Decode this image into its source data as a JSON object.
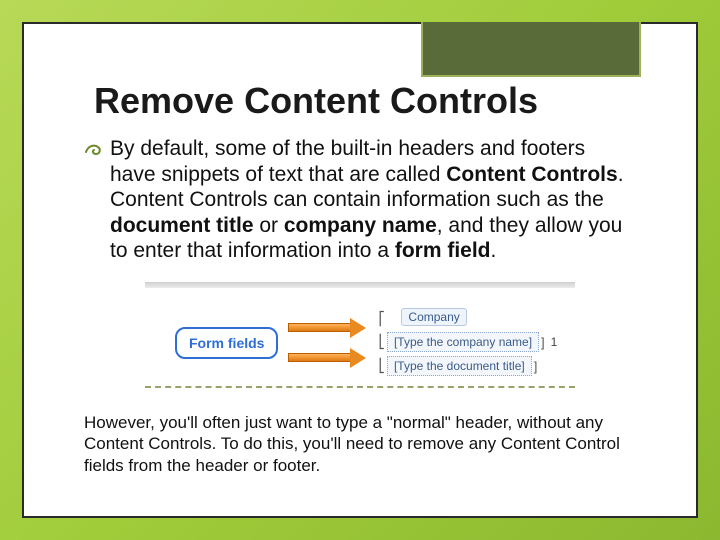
{
  "title": "Remove Content Controls",
  "body": {
    "p1_a": "By default, some of the built-in headers and footers have snippets of text that are called ",
    "p1_b": "Content Controls",
    "p1_c": ". Content Controls can contain information such as the ",
    "p1_d": "document title",
    "p1_e": " or ",
    "p1_f": "company name",
    "p1_g": ", and they allow you to enter that information into a ",
    "p1_h": "form field",
    "p1_i": "."
  },
  "diagram": {
    "badge": "Form fields",
    "company_label": "Company",
    "field_company": "[Type the company name]",
    "field_title": "[Type the document title]",
    "page_num": "1"
  },
  "footer": "However, you'll often just want to type a \"normal\" header, without any Content Controls. To do this, you'll need to remove any Content Control fields from the header or footer."
}
